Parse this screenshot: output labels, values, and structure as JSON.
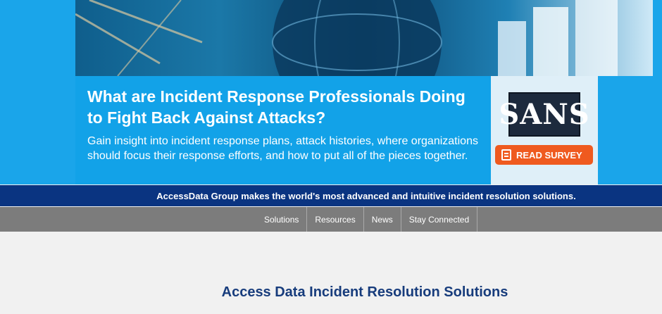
{
  "hero": {
    "headline": "What are Incident Response Professionals Doing to Fight Back Against Attacks?",
    "subtext": "Gain insight into incident response plans, attack histories, where organizations should focus their response efforts, and how to put all of the pieces together.",
    "logo_text": "SANS",
    "cta_label": "READ SURVEY"
  },
  "tagline": "AccessData Group makes the world's most advanced and intuitive incident resolution solutions.",
  "nav": {
    "items": [
      "Solutions",
      "Resources",
      "News",
      "Stay Connected"
    ]
  },
  "main": {
    "title": "Access Data Incident Resolution Solutions"
  },
  "colors": {
    "hero_blue": "#12a2e8",
    "tagline_navy": "#0a3481",
    "nav_gray": "#7c7c7c",
    "cta_orange": "#ef5a1f",
    "title_blue": "#173c7c"
  }
}
